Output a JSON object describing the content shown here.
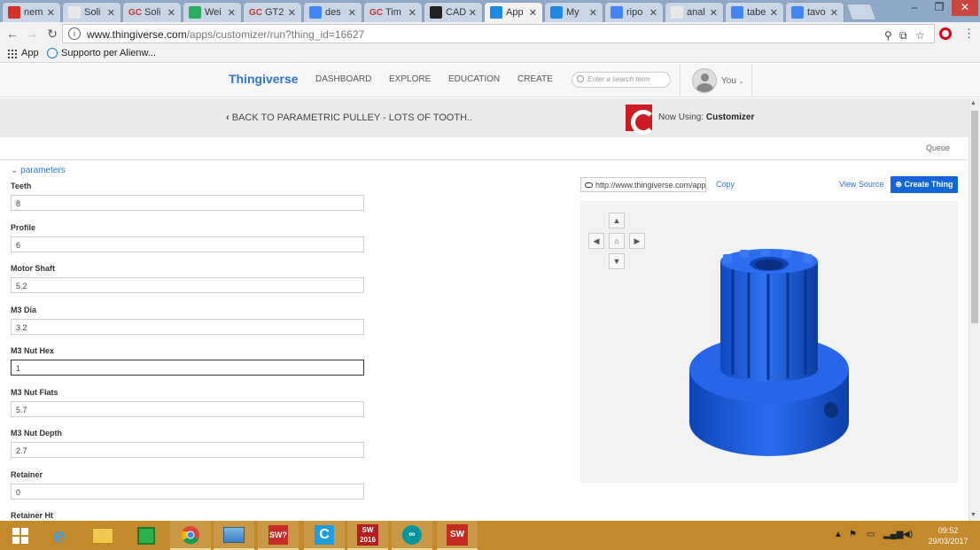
{
  "browser": {
    "tabs": [
      {
        "title": "nem",
        "icon": "gmail-icon",
        "color": "#d93025"
      },
      {
        "title": "Soli",
        "icon": "doc-icon",
        "color": "#e8e8e8"
      },
      {
        "title": "Soli",
        "icon": "gc-icon",
        "color": "#c0392b"
      },
      {
        "title": "Wei",
        "icon": "globe-icon",
        "color": "#27ae60"
      },
      {
        "title": "GT2",
        "icon": "gc-icon",
        "color": "#c0392b"
      },
      {
        "title": "des",
        "icon": "google-icon",
        "color": "#4285f4"
      },
      {
        "title": "Tim",
        "icon": "gc-icon",
        "color": "#c0392b"
      },
      {
        "title": "CAD",
        "icon": "github-icon",
        "color": "#222222"
      },
      {
        "title": "App",
        "icon": "thingiverse-icon",
        "color": "#1e88e5"
      },
      {
        "title": "My",
        "icon": "thingiverse-icon",
        "color": "#1e88e5"
      },
      {
        "title": "ripo",
        "icon": "google-icon",
        "color": "#4285f4"
      },
      {
        "title": "anal",
        "icon": "doc-icon",
        "color": "#e8e8e8"
      },
      {
        "title": "tabe",
        "icon": "google-icon",
        "color": "#4285f4"
      },
      {
        "title": "tavo",
        "icon": "google-icon",
        "color": "#4285f4"
      }
    ],
    "tab_prefixes": [
      "",
      "",
      "GC",
      "",
      "GC",
      "",
      "GC",
      "",
      "",
      "",
      "",
      "",
      "",
      ""
    ],
    "url_host": "www.thingiverse.com",
    "url_path": "/apps/customizer/run?thing_id=16627",
    "bookmarks": {
      "apps": "App",
      "support": "Supporto per Alienw..."
    }
  },
  "site": {
    "logo": "Thingiverse",
    "nav": [
      "DASHBOARD",
      "EXPLORE",
      "EDUCATION",
      "CREATE"
    ],
    "search_placeholder": "Enter a search term",
    "user": "You"
  },
  "banner": {
    "back": "BACK TO PARAMETRIC PULLEY - LOTS OF TOOTH..",
    "now_using_prefix": "Now Using: ",
    "now_using_app": "Customizer"
  },
  "queue": "Queue",
  "params": {
    "toggle": "parameters",
    "fields": [
      {
        "label": "Teeth",
        "value": "8"
      },
      {
        "label": "Profile",
        "value": "6"
      },
      {
        "label": "Motor Shaft",
        "value": "5.2"
      },
      {
        "label": "M3 Dia",
        "value": "3.2"
      },
      {
        "label": "M3 Nut Hex",
        "value": "1"
      },
      {
        "label": "M3 Nut Flats",
        "value": "5.7"
      },
      {
        "label": "M3 Nut Depth",
        "value": "2.7"
      },
      {
        "label": "Retainer",
        "value": "0"
      },
      {
        "label": "Retainer Ht",
        "value": ""
      }
    ]
  },
  "preview": {
    "link": "http://www.thingiverse.com/apps",
    "copy": "Copy",
    "view_source": "View Source",
    "create": "Create Thing",
    "model_color": "#1f5fd6"
  },
  "taskbar": {
    "time": "09:52",
    "date": "29/03/2017"
  }
}
